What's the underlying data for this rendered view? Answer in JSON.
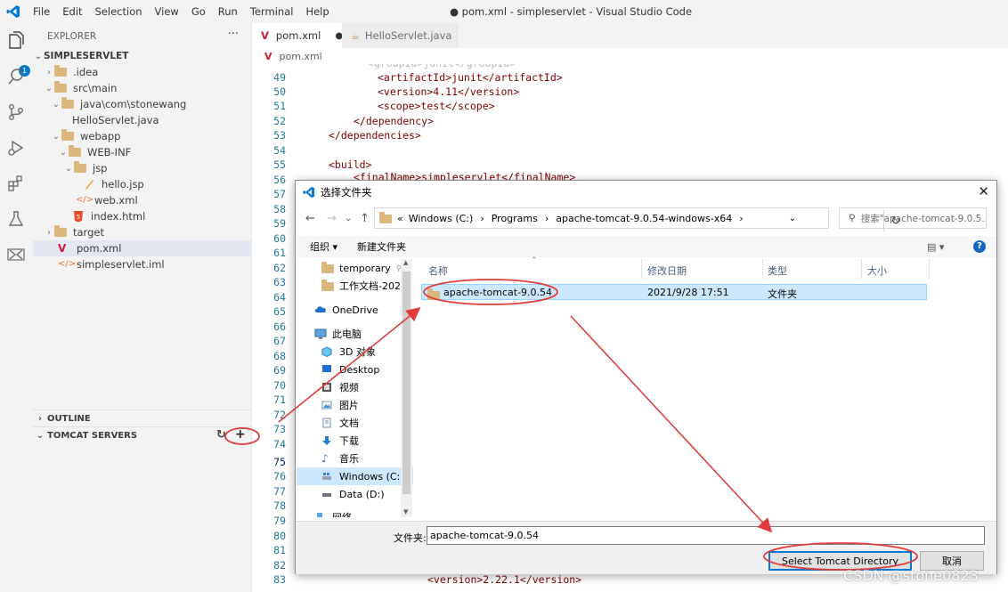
{
  "titlebar": {
    "menu": [
      "File",
      "Edit",
      "Selection",
      "View",
      "Go",
      "Run",
      "Terminal",
      "Help"
    ],
    "window_title": "● pom.xml - simpleservlet - Visual Studio Code"
  },
  "activitybar": {
    "explorer_badge": "1"
  },
  "sidebar": {
    "header": "EXPLORER",
    "more": "···",
    "root": "SIMPLESERVLET",
    "items": [
      {
        "label": ".idea"
      },
      {
        "label": "src\\main"
      },
      {
        "label": "java\\com\\stonewang"
      },
      {
        "label": "HelloServlet.java"
      },
      {
        "label": "webapp"
      },
      {
        "label": "WEB-INF"
      },
      {
        "label": "jsp"
      },
      {
        "label": "hello.jsp"
      },
      {
        "label": "web.xml"
      },
      {
        "label": "index.html"
      },
      {
        "label": "target"
      },
      {
        "label": "pom.xml"
      },
      {
        "label": "simpleservlet.iml"
      }
    ],
    "outline": "OUTLINE",
    "tomcat": "TOMCAT SERVERS"
  },
  "tabs": [
    {
      "label": "pom.xml",
      "dirty": "●"
    },
    {
      "label": "HelloServlet.java"
    }
  ],
  "breadcrumb": "pom.xml",
  "editor": {
    "lines": [
      {
        "n": "49",
        "text": "<artifactId>junit</artifactId>"
      },
      {
        "n": "50",
        "text": "<version>4.11</version>"
      },
      {
        "n": "51",
        "text": "<scope>test</scope>"
      },
      {
        "n": "52",
        "text": "</dependency>"
      },
      {
        "n": "53",
        "text": "</dependencies>"
      },
      {
        "n": "54",
        "text": ""
      },
      {
        "n": "55",
        "text": "<build>"
      },
      {
        "n": "56",
        "text": "<finalName>simpleservlet</finalName>"
      },
      {
        "n": "57",
        "text": ""
      },
      {
        "n": "58",
        "text": ""
      },
      {
        "n": "59",
        "text": ""
      },
      {
        "n": "60",
        "text": ""
      },
      {
        "n": "61",
        "text": ""
      },
      {
        "n": "62",
        "text": ""
      },
      {
        "n": "63",
        "text": ""
      },
      {
        "n": "64",
        "text": ""
      },
      {
        "n": "65",
        "text": ""
      },
      {
        "n": "66",
        "text": ""
      },
      {
        "n": "67",
        "text": ""
      },
      {
        "n": "68",
        "text": ""
      },
      {
        "n": "69",
        "text": ""
      },
      {
        "n": "70",
        "text": ""
      },
      {
        "n": "71",
        "text": ""
      },
      {
        "n": "72",
        "text": ""
      },
      {
        "n": "73",
        "text": ""
      },
      {
        "n": "74",
        "text": ""
      },
      {
        "n": "75",
        "text": ""
      },
      {
        "n": "76",
        "text": ""
      },
      {
        "n": "77",
        "text": ""
      },
      {
        "n": "78",
        "text": ""
      },
      {
        "n": "79",
        "text": ""
      },
      {
        "n": "80",
        "text": ""
      },
      {
        "n": "81",
        "text": ""
      },
      {
        "n": "82",
        "text": ""
      },
      {
        "n": "83",
        "text": "<version>2.22.1</version>"
      }
    ]
  },
  "dialog": {
    "title": "选择文件夹",
    "close": "✕",
    "address": {
      "chevrons": "«",
      "parts": [
        "Windows (C:)",
        "Programs",
        "apache-tomcat-9.0.54-windows-x64"
      ]
    },
    "search_placeholder": "搜索\"apache-tomcat-9.0.5...",
    "organize": "组织 ▾",
    "new_folder": "新建文件夹",
    "nav": [
      {
        "label": "temporary",
        "pin": "📌"
      },
      {
        "label": "工作文档-202",
        "pin": "📌"
      },
      {
        "label": "OneDrive"
      },
      {
        "label": "此电脑"
      },
      {
        "label": "3D 对象"
      },
      {
        "label": "Desktop"
      },
      {
        "label": "视频"
      },
      {
        "label": "图片"
      },
      {
        "label": "文档"
      },
      {
        "label": "下载"
      },
      {
        "label": "音乐"
      },
      {
        "label": "Windows (C:)"
      },
      {
        "label": "Data (D:)"
      },
      {
        "label": "网络"
      }
    ],
    "columns": [
      "名称",
      "修改日期",
      "类型",
      "大小"
    ],
    "files": [
      {
        "name": "apache-tomcat-9.0.54",
        "date": "2021/9/28 17:51",
        "type": "文件夹"
      }
    ],
    "filename_label": "文件夹:",
    "filename_value": "apache-tomcat-9.0.54",
    "select_button": "Select Tomcat Directory",
    "cancel_button": "取消"
  },
  "watermark": "CSDN @stone0823",
  "colors": {
    "annotation": "#e23b3b",
    "accent": "#007acc",
    "selection": "#cce8ff"
  }
}
